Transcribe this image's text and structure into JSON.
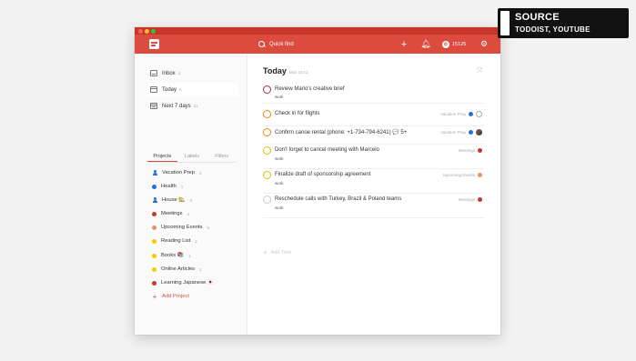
{
  "topbar": {
    "search_placeholder": "Quick find",
    "karma_label": "15125",
    "brand_color": "#db4c3f"
  },
  "sidebar": {
    "nav": [
      {
        "label": "Inbox",
        "count": "4",
        "icon": "inbox-icon"
      },
      {
        "label": "Today",
        "count": "6",
        "icon": "calendar-icon"
      },
      {
        "label": "Next 7 days",
        "count": "11",
        "icon": "calendar-week-icon"
      }
    ],
    "tabs": [
      "Projects",
      "Labels",
      "Filters"
    ],
    "projects": [
      {
        "label": "Vacation Prep",
        "count": "4",
        "color": "#246fe0",
        "icon": "person-icon"
      },
      {
        "label": "Health",
        "count": "1",
        "color": "#246fe0"
      },
      {
        "label": "House 🏡",
        "count": "5",
        "color": "#246fe0",
        "icon": "person-icon"
      },
      {
        "label": "Meetings",
        "count": "4",
        "color": "#c0392b"
      },
      {
        "label": "Upcoming Events",
        "count": "5",
        "color": "#eb8c6e"
      },
      {
        "label": "Reading List",
        "count": "2",
        "color": "#f5cc00"
      },
      {
        "label": "Books 📚",
        "count": "1",
        "color": "#f5cc00"
      },
      {
        "label": "Online Articles",
        "count": "2",
        "color": "#f5cc00"
      },
      {
        "label": "Learning Japanese 🇯🇵",
        "count": "",
        "color": "#c0392b"
      }
    ],
    "add_project": "Add Project"
  },
  "main": {
    "title": "Today",
    "date": "Mon Oct 2",
    "tasks": [
      {
        "title": "Review Mario's creative brief",
        "label": "work",
        "project": "",
        "check_color": "#a4275a"
      },
      {
        "title": "Check in for flights",
        "label": "",
        "project": "Vacation Prep",
        "project_color": "#246fe0",
        "check_color": "#eb8909",
        "assignee": "person-icon"
      },
      {
        "title": "Confirm canoe rental (phone: +1-734-794-6241) 💬 5+",
        "label": "",
        "project": "Vacation Prep",
        "project_color": "#246fe0",
        "check_color": "#eb8909",
        "assignee": "avatar"
      },
      {
        "title": "Don't forget to cancel meeting with Marcelo",
        "label": "work",
        "project": "Meetings",
        "project_color": "#c0392b",
        "check_color": "#d8c400"
      },
      {
        "title": "Finalize draft of sponsorship agreement",
        "label": "work",
        "project": "Upcoming Events",
        "project_color": "#eb8c6e",
        "check_color": "#d8c400"
      },
      {
        "title": "Reschedule calls with Turkey, Brazil & Poland teams",
        "label": "work",
        "project": "Meetings",
        "project_color": "#c0392b",
        "check_color": "#cccccc"
      }
    ],
    "add_task": "Add Task"
  },
  "source": {
    "title": "SOURCE",
    "subtitle": "TODOIST, YOUTUBE"
  }
}
